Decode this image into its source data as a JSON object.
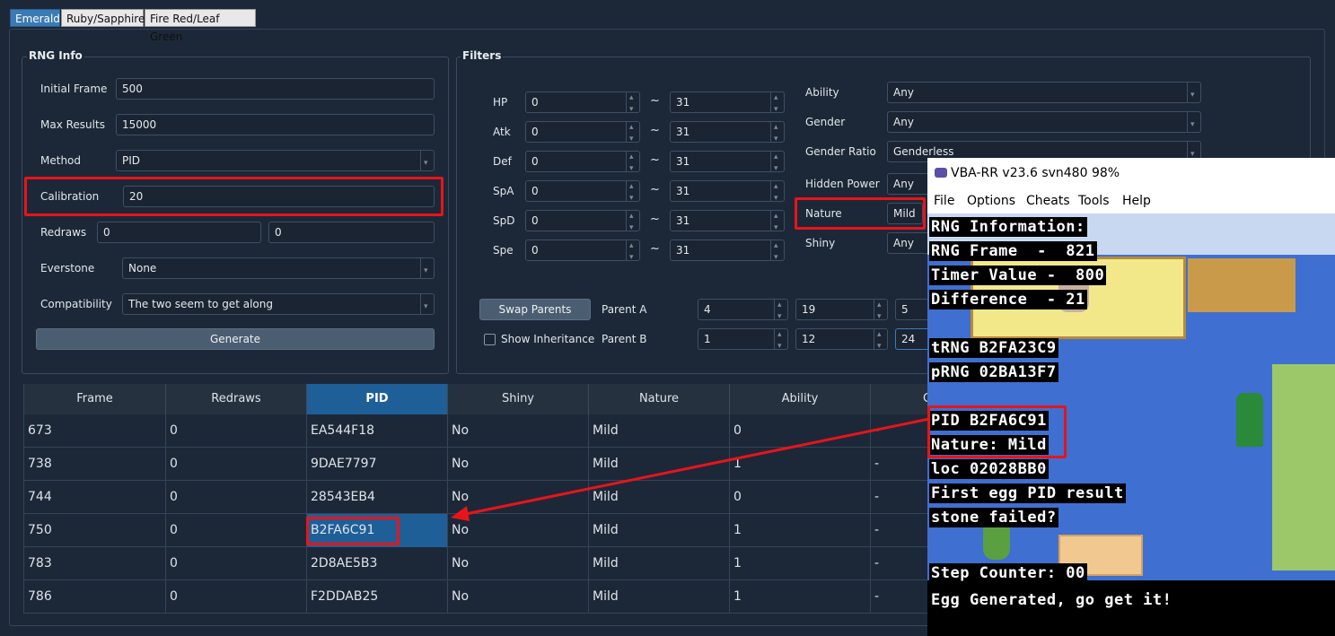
{
  "tabs": [
    "Emerald",
    "Ruby/Sapphire",
    "Fire Red/Leaf Green"
  ],
  "rng_info": {
    "title": "RNG Info",
    "initial_frame_label": "Initial Frame",
    "initial_frame": "500",
    "max_results_label": "Max Results",
    "max_results": "15000",
    "method_label": "Method",
    "method": "PID",
    "calibration_label": "Calibration",
    "calibration": "20",
    "redraws_label": "Redraws",
    "redraws_min": "0",
    "redraws_max": "0",
    "everstone_label": "Everstone",
    "everstone": "None",
    "compatibility_label": "Compatibility",
    "compatibility": "The two seem to get along",
    "generate_label": "Generate"
  },
  "filters": {
    "title": "Filters",
    "ivs": [
      {
        "stat": "HP",
        "min": "0",
        "max": "31"
      },
      {
        "stat": "Atk",
        "min": "0",
        "max": "31"
      },
      {
        "stat": "Def",
        "min": "0",
        "max": "31"
      },
      {
        "stat": "SpA",
        "min": "0",
        "max": "31"
      },
      {
        "stat": "SpD",
        "min": "0",
        "max": "31"
      },
      {
        "stat": "Spe",
        "min": "0",
        "max": "31"
      }
    ],
    "tilde": "~",
    "ability_label": "Ability",
    "ability": "Any",
    "gender_label": "Gender",
    "gender": "Any",
    "gender_ratio_label": "Gender Ratio",
    "gender_ratio": "Genderless",
    "hidden_power_label": "Hidden Power",
    "hidden_power": "Any",
    "nature_label": "Nature",
    "nature": "Mild",
    "shiny_label": "Shiny",
    "shiny": "Any",
    "swap_parents_label": "Swap Parents",
    "show_inheritance_label": "Show Inheritance",
    "parent_a_label": "Parent A",
    "parent_a": [
      "4",
      "19",
      "5"
    ],
    "parent_b_label": "Parent B",
    "parent_b": [
      "1",
      "12",
      "24"
    ]
  },
  "table": {
    "columns": [
      "Frame",
      "Redraws",
      "PID",
      "Shiny",
      "Nature",
      "Ability",
      "G"
    ],
    "rows": [
      {
        "frame": "673",
        "redraws": "0",
        "pid": "EA544F18",
        "shiny": "No",
        "nature": "Mild",
        "ability": "0",
        "g": "-"
      },
      {
        "frame": "738",
        "redraws": "0",
        "pid": "9DAE7797",
        "shiny": "No",
        "nature": "Mild",
        "ability": "1",
        "g": "-"
      },
      {
        "frame": "744",
        "redraws": "0",
        "pid": "28543EB4",
        "shiny": "No",
        "nature": "Mild",
        "ability": "0",
        "g": "-"
      },
      {
        "frame": "750",
        "redraws": "0",
        "pid": "B2FA6C91",
        "shiny": "No",
        "nature": "Mild",
        "ability": "1",
        "g": "-"
      },
      {
        "frame": "783",
        "redraws": "0",
        "pid": "2D8AE5B3",
        "shiny": "No",
        "nature": "Mild",
        "ability": "1",
        "g": "-"
      },
      {
        "frame": "786",
        "redraws": "0",
        "pid": "F2DDAB25",
        "shiny": "No",
        "nature": "Mild",
        "ability": "1",
        "g": "-"
      }
    ]
  },
  "vba": {
    "title": "VBA-RR v23.6 svn480  98%",
    "menu": [
      "File",
      "Options",
      "Cheats",
      "Tools",
      "Help"
    ],
    "overlay": [
      "RNG Information:",
      "RNG Frame  -  821",
      "Timer Value -  800",
      "Difference  - 21",
      "tRNG B2FA23C9",
      "pRNG 02BA13F7",
      "PID B2FA6C91",
      "Nature: Mild",
      "loc 02028BB0",
      "First egg PID result",
      "stone failed?",
      "Step Counter: 00",
      "Egg Generated, go get it!"
    ]
  },
  "colors": {
    "highlight": "#e8141b",
    "accent": "#1f5f98",
    "background": "#1c2838"
  }
}
